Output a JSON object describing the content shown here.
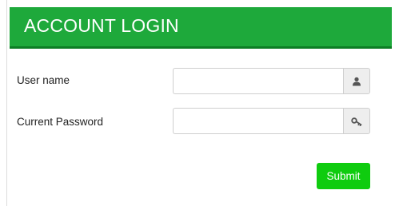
{
  "header": {
    "title": "ACCOUNT LOGIN"
  },
  "form": {
    "username": {
      "label": "User name",
      "value": "",
      "placeholder": "",
      "icon": "user-icon"
    },
    "password": {
      "label": "Current Password",
      "value": "",
      "placeholder": "",
      "icon": "key-icon"
    },
    "submit_label": "Submit"
  },
  "colors": {
    "header_bg": "#1ea93b",
    "header_border": "#0c7d24",
    "submit_bg": "#0fcc0f",
    "addon_bg": "#eeeeee"
  }
}
